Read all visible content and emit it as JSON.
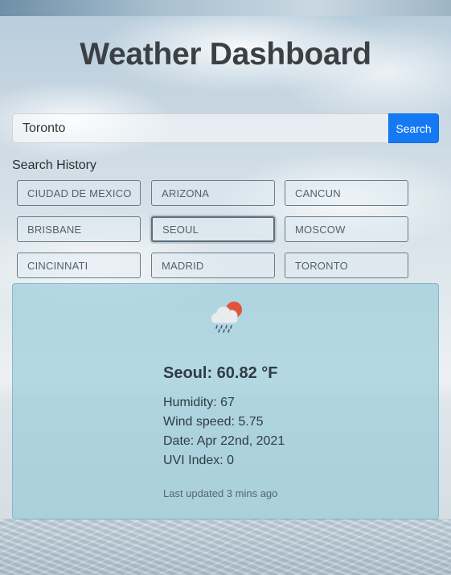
{
  "header": {
    "title": "Weather Dashboard"
  },
  "search": {
    "value": "Toronto",
    "button_label": "Search"
  },
  "history": {
    "label": "Search History",
    "items": [
      "CIUDAD DE MEXICO",
      "ARIZONA",
      "CANCUN",
      "BRISBANE",
      "SEOUL",
      "MOSCOW",
      "CINCINNATI",
      "MADRID",
      "TORONTO"
    ],
    "selected": "SEOUL"
  },
  "weather": {
    "icon": "rain-cloud-sun-icon",
    "city_temp": "Seoul: 60.82 °F",
    "humidity": "Humidity: 67",
    "wind": "Wind speed: 5.75",
    "date": "Date: Apr 22nd, 2021",
    "uvi": "UVI Index: 0",
    "updated": "Last updated 3 mins ago"
  },
  "colors": {
    "accent": "#1479f3",
    "card": "#85c4d6",
    "title": "#3b4045"
  }
}
